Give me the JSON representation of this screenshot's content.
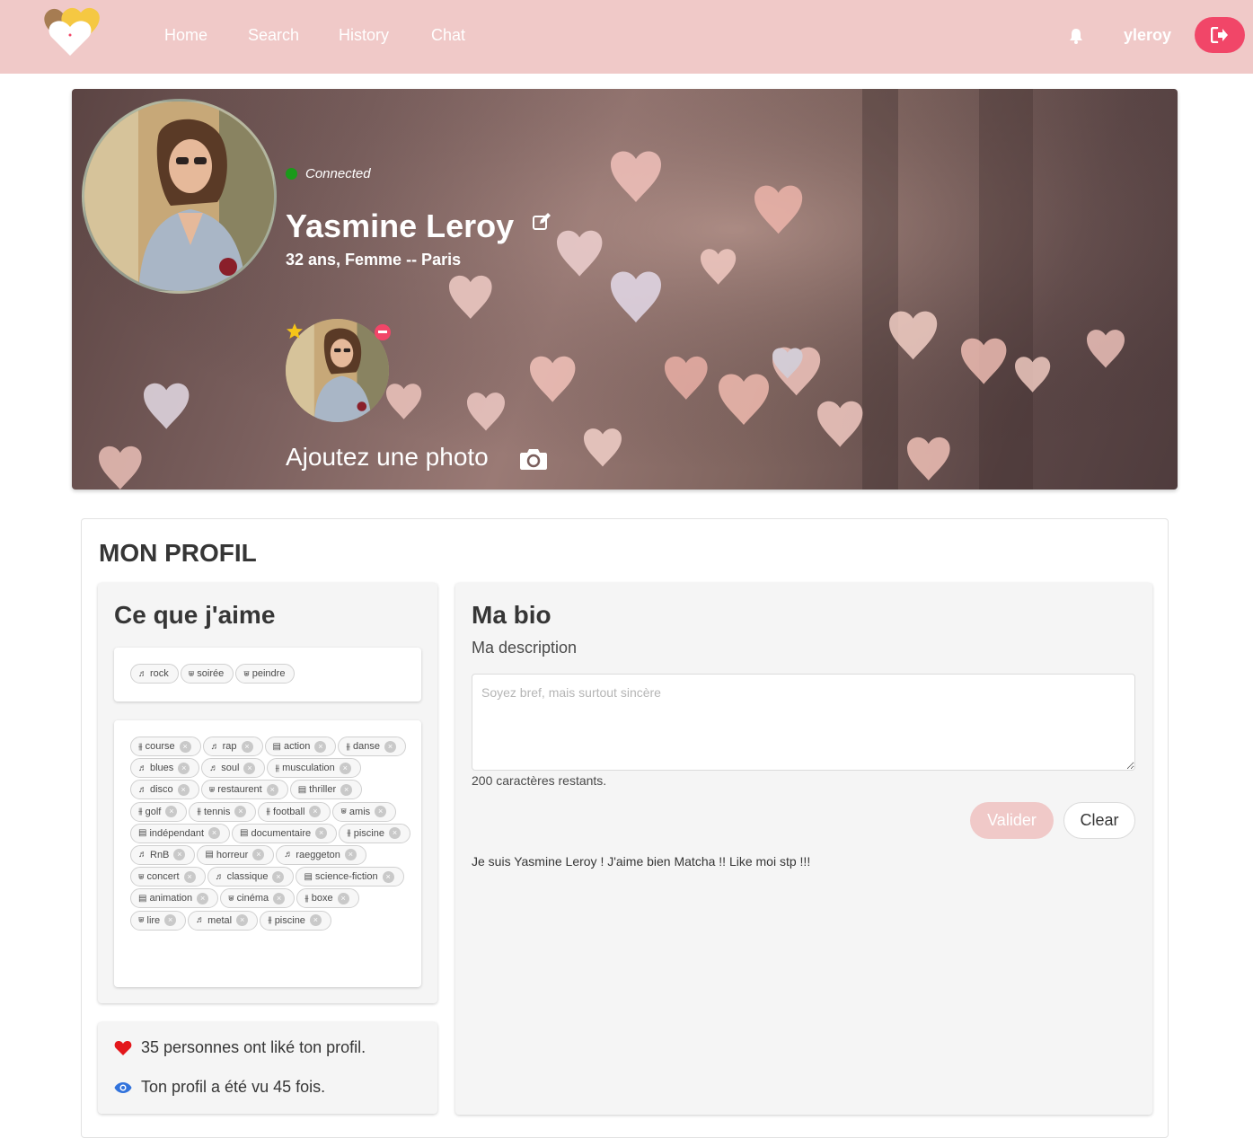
{
  "navbar": {
    "links": [
      "Home",
      "Search",
      "History",
      "Chat"
    ],
    "username": "yleroy",
    "icons": [
      "logo-hearts-icon",
      "bell-icon",
      "sign-out-icon"
    ],
    "accent": "#f14668",
    "background": "#f0c9c8"
  },
  "hero": {
    "status": "Connected",
    "status_color": "#1a9a1a",
    "name": "Yasmine Leroy",
    "subtitle": "32 ans, Femme -- Paris",
    "add_photo": "Ajoutez une photo"
  },
  "profile": {
    "title": "MON PROFIL",
    "likes_card": {
      "title": "Ce que j'aime",
      "selected_tags": [
        {
          "icon": "music",
          "label": "rock"
        },
        {
          "icon": "cocktail",
          "label": "soirée"
        },
        {
          "icon": "cocktail",
          "label": "peindre"
        }
      ],
      "available_tags": [
        {
          "icon": "dumbbell",
          "label": "course"
        },
        {
          "icon": "music",
          "label": "rap"
        },
        {
          "icon": "film",
          "label": "action"
        },
        {
          "icon": "dumbbell",
          "label": "danse"
        },
        {
          "icon": "music",
          "label": "blues"
        },
        {
          "icon": "music",
          "label": "soul"
        },
        {
          "icon": "dumbbell",
          "label": "musculation"
        },
        {
          "icon": "music",
          "label": "disco"
        },
        {
          "icon": "cocktail",
          "label": "restaurent"
        },
        {
          "icon": "film",
          "label": "thriller"
        },
        {
          "icon": "dumbbell",
          "label": "golf"
        },
        {
          "icon": "dumbbell",
          "label": "tennis"
        },
        {
          "icon": "dumbbell",
          "label": "football"
        },
        {
          "icon": "cocktail",
          "label": "amis"
        },
        {
          "icon": "film",
          "label": "indépendant"
        },
        {
          "icon": "film",
          "label": "documentaire"
        },
        {
          "icon": "dumbbell",
          "label": "piscine"
        },
        {
          "icon": "music",
          "label": "RnB"
        },
        {
          "icon": "film",
          "label": "horreur"
        },
        {
          "icon": "music",
          "label": "raeggeton"
        },
        {
          "icon": "cocktail",
          "label": "concert"
        },
        {
          "icon": "music",
          "label": "classique"
        },
        {
          "icon": "film",
          "label": "science-fiction"
        },
        {
          "icon": "film",
          "label": "animation"
        },
        {
          "icon": "cocktail",
          "label": "cinéma"
        },
        {
          "icon": "dumbbell",
          "label": "boxe"
        },
        {
          "icon": "cocktail",
          "label": "lire"
        },
        {
          "icon": "music",
          "label": "metal"
        },
        {
          "icon": "dumbbell",
          "label": "piscine"
        }
      ]
    },
    "stats": {
      "likes_text": "35 personnes ont liké ton profil.",
      "views_text": "Ton profil a été vu 45 fois.",
      "heart_color": "#e3171b",
      "eye_color": "#3273dc"
    },
    "bio_card": {
      "title": "Ma bio",
      "subtitle": "Ma description",
      "placeholder": "Soyez bref, mais surtout sincère",
      "value": "",
      "remaining": "200 caractères restants.",
      "valider_label": "Valider",
      "clear_label": "Clear",
      "bio_text": "Je suis Yasmine Leroy ! J'aime bien Matcha !! Like moi stp !!!"
    }
  }
}
